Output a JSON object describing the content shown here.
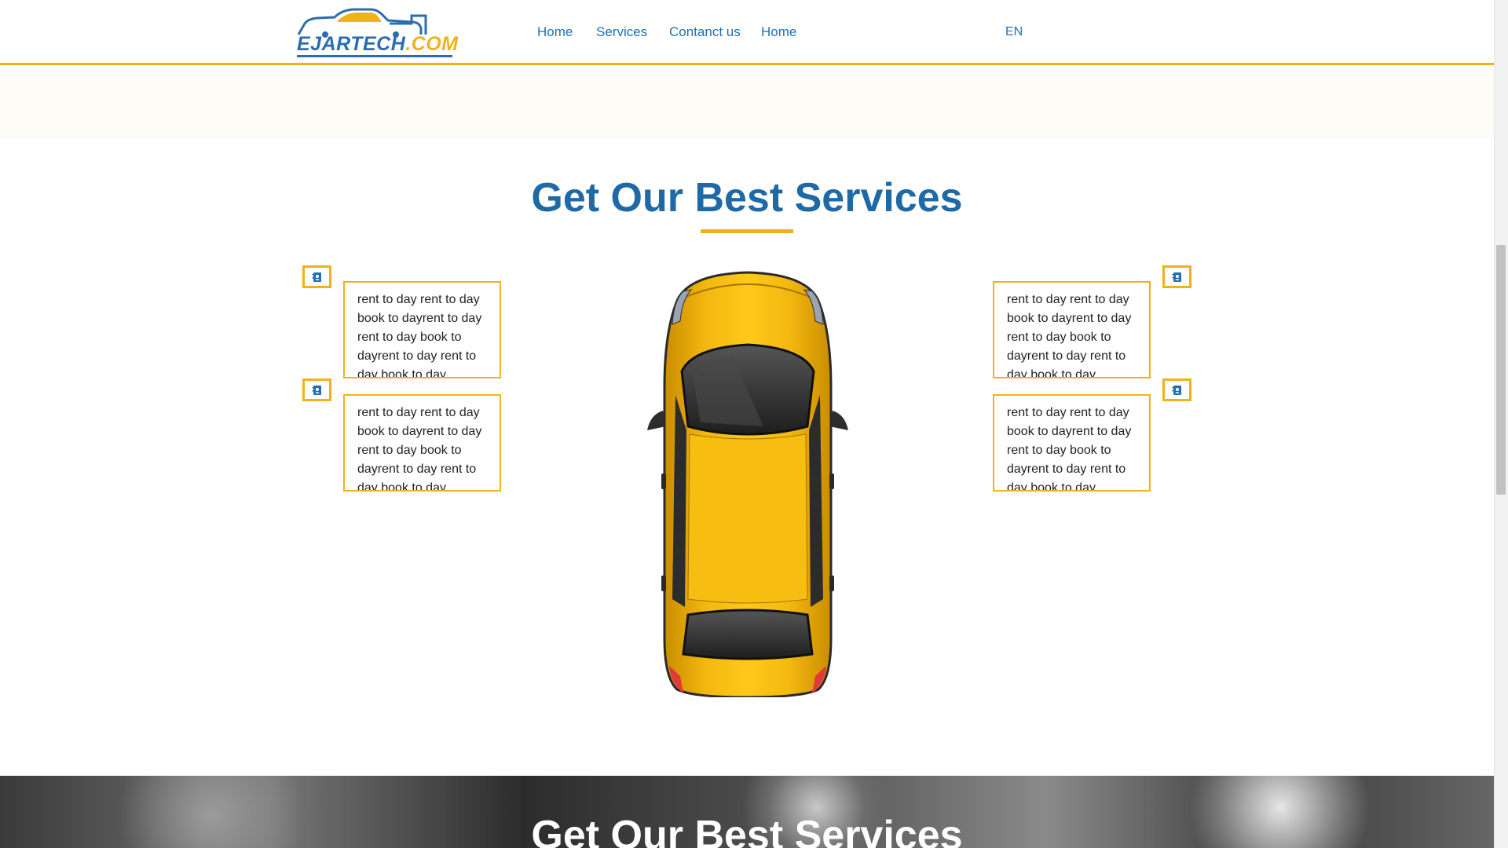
{
  "header": {
    "logo": {
      "text_main": "EJARTECH",
      "text_suffix": ".COM"
    },
    "nav": [
      {
        "label": "Home"
      },
      {
        "label": "Services"
      },
      {
        "label": "Contanct us"
      },
      {
        "label": "Home"
      }
    ],
    "language": "EN"
  },
  "services": {
    "title": "Get Our Best Services",
    "cards": [
      {
        "icon": "contact-book-icon",
        "text": "rent to day rent to day book to dayrent to day rent to day book to dayrent to day rent to day book to day"
      },
      {
        "icon": "contact-book-icon",
        "text": "rent to day rent to day book to dayrent to day rent to day book to dayrent to day rent to day book to day"
      },
      {
        "icon": "contact-book-icon",
        "text": "rent to day rent to day book to dayrent to day rent to day book to dayrent to day rent to day book to day"
      },
      {
        "icon": "contact-book-icon",
        "text": "rent to day rent to day book to dayrent to day rent to day book to dayrent to day rent to day book to day"
      }
    ],
    "center_image": "yellow-car-top-view"
  },
  "banner": {
    "title": "Get Our Best Services"
  },
  "colors": {
    "brand_blue": "#1f6aa6",
    "accent_yellow": "#f0b21a",
    "car_yellow": "#f3b80f"
  }
}
